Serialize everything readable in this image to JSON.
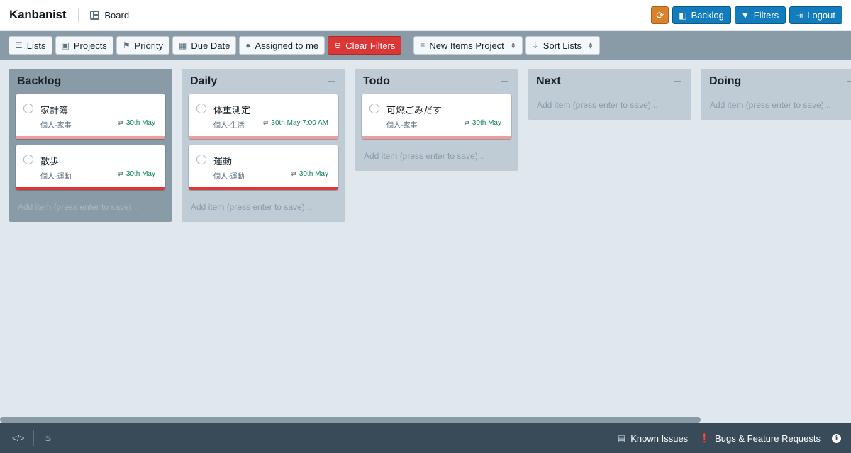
{
  "app": {
    "brand": "Kanbanist",
    "view_label": "Board"
  },
  "nav_actions": {
    "backlog": "Backlog",
    "filters": "Filters",
    "logout": "Logout"
  },
  "toolbar": {
    "lists": "Lists",
    "projects": "Projects",
    "priority": "Priority",
    "due_date": "Due Date",
    "assigned": "Assigned to me",
    "clear_filters": "Clear Filters",
    "new_items_project": "New Items Project",
    "sort_lists": "Sort Lists"
  },
  "add_item_placeholder": "Add item (press enter to save)...",
  "columns": [
    {
      "title": "Backlog",
      "active": true,
      "cards": [
        {
          "title": "家計簿",
          "project": "個人-家事",
          "due": "30th May",
          "priority_color": "#f29d9d"
        },
        {
          "title": "散歩",
          "project": "個人-運動",
          "due": "30th May",
          "priority_color": "#db3737"
        }
      ]
    },
    {
      "title": "Daily",
      "active": false,
      "cards": [
        {
          "title": "体重測定",
          "project": "個人-生活",
          "due": "30th May 7:00 AM",
          "priority_color": "#f29d9d"
        },
        {
          "title": "運動",
          "project": "個人-運動",
          "due": "30th May",
          "priority_color": "#db3737"
        }
      ]
    },
    {
      "title": "Todo",
      "active": false,
      "cards": [
        {
          "title": "可燃ごみだす",
          "project": "個人-家事",
          "due": "30th May",
          "priority_color": "#f29d9d"
        }
      ]
    },
    {
      "title": "Next",
      "active": false,
      "cards": []
    },
    {
      "title": "Doing",
      "active": false,
      "cards": []
    }
  ],
  "footer": {
    "known_issues": "Known Issues",
    "bugs": "Bugs & Feature Requests"
  },
  "colors": {
    "accent": "#137cbd",
    "sync": "#d9822b",
    "danger": "#db3737",
    "footer": "#394b59"
  }
}
